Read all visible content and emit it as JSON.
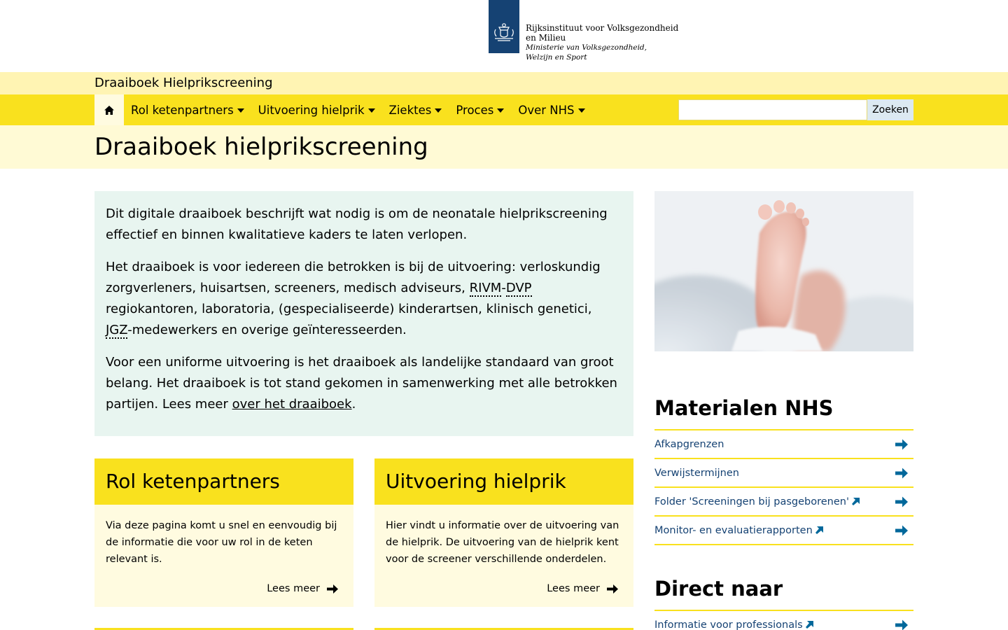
{
  "header": {
    "org_line1": "Rijksinstituut voor Volksgezondheid",
    "org_line2": "en Milieu",
    "ministry_line1": "Ministerie van Volksgezondheid,",
    "ministry_line2": "Welzijn en Sport",
    "logo_icon": "crest-icon"
  },
  "site": {
    "title": "Draaiboek Hielprikscreening"
  },
  "nav": {
    "home_icon": "home-icon",
    "items": [
      {
        "label": "Rol ketenpartners"
      },
      {
        "label": "Uitvoering hielprik"
      },
      {
        "label": "Ziektes"
      },
      {
        "label": "Proces"
      },
      {
        "label": "Over NHS"
      }
    ],
    "search_placeholder": "",
    "search_button": "Zoeken"
  },
  "page": {
    "title": "Draaiboek hielprikscreening"
  },
  "intro": {
    "p1": "Dit digitale draaiboek beschrijft wat nodig is om de neonatale hielprikscreening effectief en binnen kwalitatieve kaders te laten verlopen.",
    "p2_a": "Het draaiboek is voor iedereen die betrokken is bij de uitvoering: verloskundig zorgverleners, huisartsen, screeners, medisch adviseurs, ",
    "p2_abbr1": "RIVM",
    "p2_dash": "-",
    "p2_abbr2": "DVP",
    "p2_b": " regiokantoren, laboratoria, (gespecialiseerde) kinderartsen, klinisch genetici, ",
    "p2_abbr3": "JGZ",
    "p2_c": "-medewerkers en overige geïnteresseerden.",
    "p3_a": "Voor een uniforme uitvoering is het draaiboek als landelijke standaard van groot belang. Het draaiboek is tot stand gekomen in samenwerking met alle betrokken partijen. Lees meer ",
    "p3_link": "over het draaiboek",
    "p3_end": "."
  },
  "cards": [
    {
      "title": "Rol ketenpartners",
      "text": "Via deze pagina komt u snel en eenvoudig bij de informatie die voor uw rol in de keten relevant is.",
      "more": "Lees meer"
    },
    {
      "title": "Uitvoering hielprik",
      "text": "Hier vindt u informatie over de uitvoering van de hielprik. De uitvoering van de hielprik kent voor de screener verschillende onderdelen.",
      "more": "Lees meer"
    }
  ],
  "materials": {
    "heading": "Materialen NHS",
    "items": [
      {
        "label": "Afkapgrenzen",
        "external": false
      },
      {
        "label": "Verwijstermijnen",
        "external": false
      },
      {
        "label": "Folder 'Screeningen bij pasgeborenen'",
        "external": true
      },
      {
        "label": "Monitor- en evaluatierapporten",
        "external": true
      }
    ]
  },
  "direct": {
    "heading": "Direct naar",
    "items": [
      {
        "label": "Informatie voor professionals",
        "external": true
      }
    ]
  },
  "colors": {
    "yellow": "#f9e11e",
    "light_yellow": "#fff4b3",
    "pale_yellow": "#fffad5",
    "mint": "#e8f5f0",
    "blue": "#154273",
    "link_blue": "#01689b"
  }
}
